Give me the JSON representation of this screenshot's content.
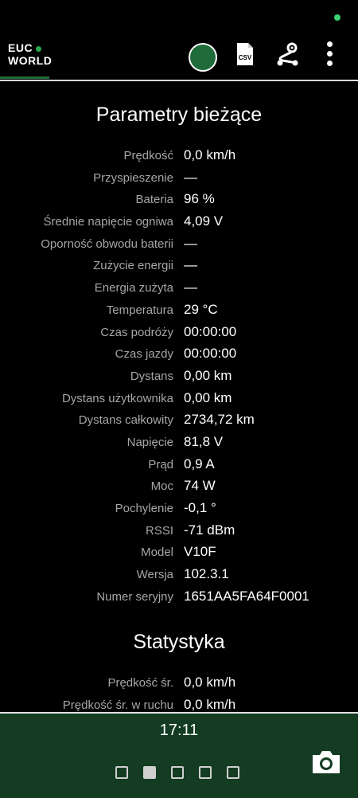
{
  "app": {
    "logo_line1": "EUC",
    "logo_line2": "WORLD"
  },
  "toolbar": {
    "csv_label": "CSV",
    "icons": [
      "record-button",
      "csv-export-icon",
      "route-icon",
      "more-vert-icon"
    ]
  },
  "current": {
    "title": "Parametry bieżące",
    "rows": [
      {
        "label": "Prędkość",
        "value": "0,0 km/h"
      },
      {
        "label": "Przyspieszenie",
        "value": "—"
      },
      {
        "label": "Bateria",
        "value": "96 %"
      },
      {
        "label": "Średnie napięcie ogniwa",
        "value": "4,09 V"
      },
      {
        "label": "Oporność obwodu baterii",
        "value": "—"
      },
      {
        "label": "Zużycie energii",
        "value": "—"
      },
      {
        "label": "Energia zużyta",
        "value": "—"
      },
      {
        "label": "Temperatura",
        "value": "29 °C"
      },
      {
        "label": "Czas podróży",
        "value": "00:00:00"
      },
      {
        "label": "Czas jazdy",
        "value": "00:00:00"
      },
      {
        "label": "Dystans",
        "value": "0,00 km"
      },
      {
        "label": "Dystans użytkownika",
        "value": "0,00 km"
      },
      {
        "label": "Dystans całkowity",
        "value": "2734,72 km"
      },
      {
        "label": "Napięcie",
        "value": "81,8 V"
      },
      {
        "label": "Prąd",
        "value": "0,9 A"
      },
      {
        "label": "Moc",
        "value": "74 W"
      },
      {
        "label": "Pochylenie",
        "value": "-0,1 °"
      },
      {
        "label": "RSSI",
        "value": "-71 dBm"
      },
      {
        "label": "Model",
        "value": "V10F"
      },
      {
        "label": "Wersja",
        "value": "102.3.1"
      },
      {
        "label": "Numer seryjny",
        "value": "1651AA5FA64F0001"
      }
    ]
  },
  "stats": {
    "title": "Statystyka",
    "rows": [
      {
        "label": "Prędkość śr.",
        "value": "0,0 km/h"
      },
      {
        "label": "Prędkość śr. w ruchu",
        "value": "0,0 km/h"
      }
    ]
  },
  "bottom_bar": {
    "clock": "17:11",
    "pages_total": 5,
    "active_page": 2
  },
  "colors": {
    "background": "#000000",
    "accent_green": "#1f6b3a",
    "bottom_bar": "#133c22",
    "label_grey": "#a6a6a6"
  }
}
